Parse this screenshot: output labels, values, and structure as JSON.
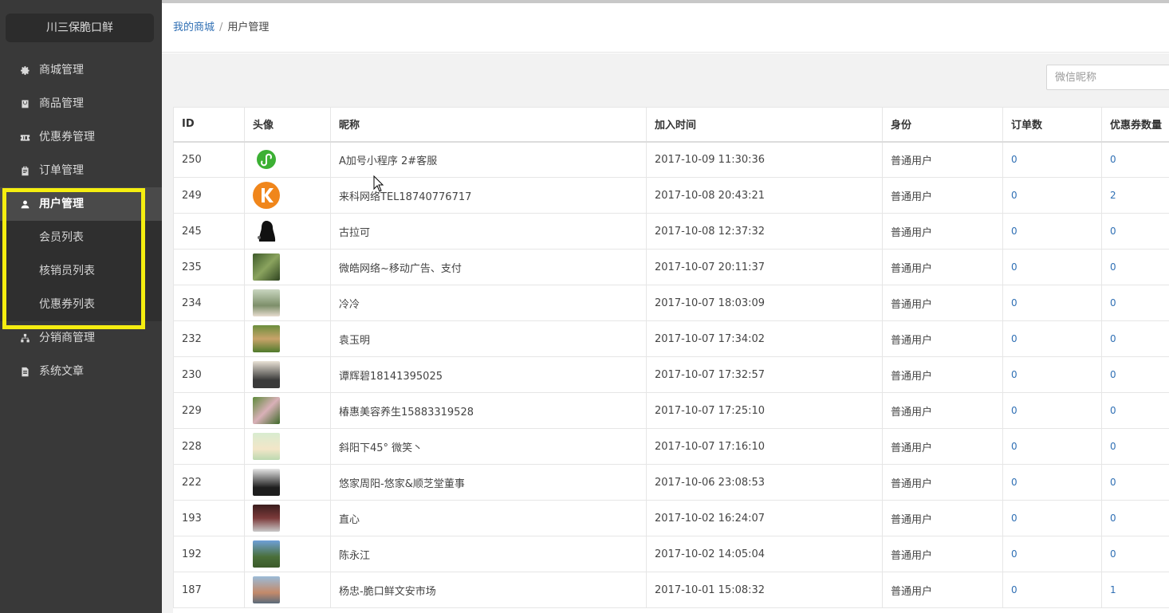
{
  "sidebar": {
    "brand": "川三保脆口鲜",
    "menu": [
      {
        "label": "商城管理",
        "icon": "gear-icon"
      },
      {
        "label": "商品管理",
        "icon": "shopping-bag-icon"
      },
      {
        "label": "优惠券管理",
        "icon": "ticket-icon"
      },
      {
        "label": "订单管理",
        "icon": "clipboard-icon"
      },
      {
        "label": "用户管理",
        "icon": "user-icon"
      },
      {
        "label": "分销商管理",
        "icon": "sitemap-icon"
      },
      {
        "label": "系统文章",
        "icon": "document-icon"
      }
    ],
    "submenu": [
      {
        "label": "会员列表"
      },
      {
        "label": "核销员列表"
      },
      {
        "label": "优惠券列表"
      }
    ]
  },
  "breadcrumb": {
    "home": "我的商城",
    "separator": "/",
    "current": "用户管理"
  },
  "search": {
    "placeholder": "微信昵称"
  },
  "table": {
    "headers": [
      "ID",
      "头像",
      "昵称",
      "加入时间",
      "身份",
      "订单数",
      "优惠券数量"
    ],
    "rows": [
      {
        "id": "250",
        "avatar": "green-miniprogram-logo",
        "nickname": "A加号小程序 2#客服",
        "joined": "2017-10-09 11:30:36",
        "role": "普通用户",
        "orders": "0",
        "coupons": "0"
      },
      {
        "id": "249",
        "avatar": "orange-k-logo",
        "nickname": "来科网络TEL18740776717",
        "joined": "2017-10-08 20:43:21",
        "role": "普通用户",
        "orders": "0",
        "coupons": "2"
      },
      {
        "id": "245",
        "avatar": "black-silhouette",
        "nickname": "古拉可",
        "joined": "2017-10-08 12:37:32",
        "role": "普通用户",
        "orders": "0",
        "coupons": "0"
      },
      {
        "id": "235",
        "avatar": "photo-forest",
        "nickname": "微皓网络~移动广告、支付",
        "joined": "2017-10-07 20:11:37",
        "role": "普通用户",
        "orders": "0",
        "coupons": "0"
      },
      {
        "id": "234",
        "avatar": "photo-woman",
        "nickname": "冷冷",
        "joined": "2017-10-07 18:03:09",
        "role": "普通用户",
        "orders": "0",
        "coupons": "0"
      },
      {
        "id": "232",
        "avatar": "photo-field",
        "nickname": "袁玉明",
        "joined": "2017-10-07 17:34:02",
        "role": "普通用户",
        "orders": "0",
        "coupons": "0"
      },
      {
        "id": "230",
        "avatar": "photo-person",
        "nickname": "谭辉碧18141395025",
        "joined": "2017-10-07 17:32:57",
        "role": "普通用户",
        "orders": "0",
        "coupons": "0"
      },
      {
        "id": "229",
        "avatar": "photo-garden",
        "nickname": "椿惠美容养生15883319528",
        "joined": "2017-10-07 17:25:10",
        "role": "普通用户",
        "orders": "0",
        "coupons": "0"
      },
      {
        "id": "228",
        "avatar": "photo-cartoon",
        "nickname": "斜阳下45° 微笑丶",
        "joined": "2017-10-07 17:16:10",
        "role": "普通用户",
        "orders": "0",
        "coupons": "0"
      },
      {
        "id": "222",
        "avatar": "photo-man-suit",
        "nickname": "悠家周阳-悠家&顺芝堂董事",
        "joined": "2017-10-06 23:08:53",
        "role": "普通用户",
        "orders": "0",
        "coupons": "0"
      },
      {
        "id": "193",
        "avatar": "photo-stage",
        "nickname": "直心",
        "joined": "2017-10-02 16:24:07",
        "role": "普通用户",
        "orders": "0",
        "coupons": "0"
      },
      {
        "id": "192",
        "avatar": "photo-mountain",
        "nickname": "陈永江",
        "joined": "2017-10-02 14:05:04",
        "role": "普通用户",
        "orders": "0",
        "coupons": "0"
      },
      {
        "id": "187",
        "avatar": "photo-man",
        "nickname": "杨忠-脆口鲜文安市场",
        "joined": "2017-10-01 15:08:32",
        "role": "普通用户",
        "orders": "0",
        "coupons": "1"
      }
    ]
  },
  "colors": {
    "sidebar_bg": "#393939",
    "link": "#2f6fb4",
    "highlight": "#f5ee10"
  }
}
